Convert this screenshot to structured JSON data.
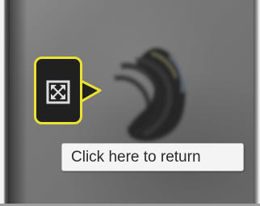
{
  "tooltip": {
    "text": "Click here to return"
  },
  "expand_button": {
    "icon": "expand-icon"
  },
  "colors": {
    "highlight_border": "#e9e230",
    "button_background": "#202020",
    "icon_color": "#dcdcdc",
    "tooltip_background": "#f4f4f4",
    "tooltip_text": "#2a2a2a"
  }
}
